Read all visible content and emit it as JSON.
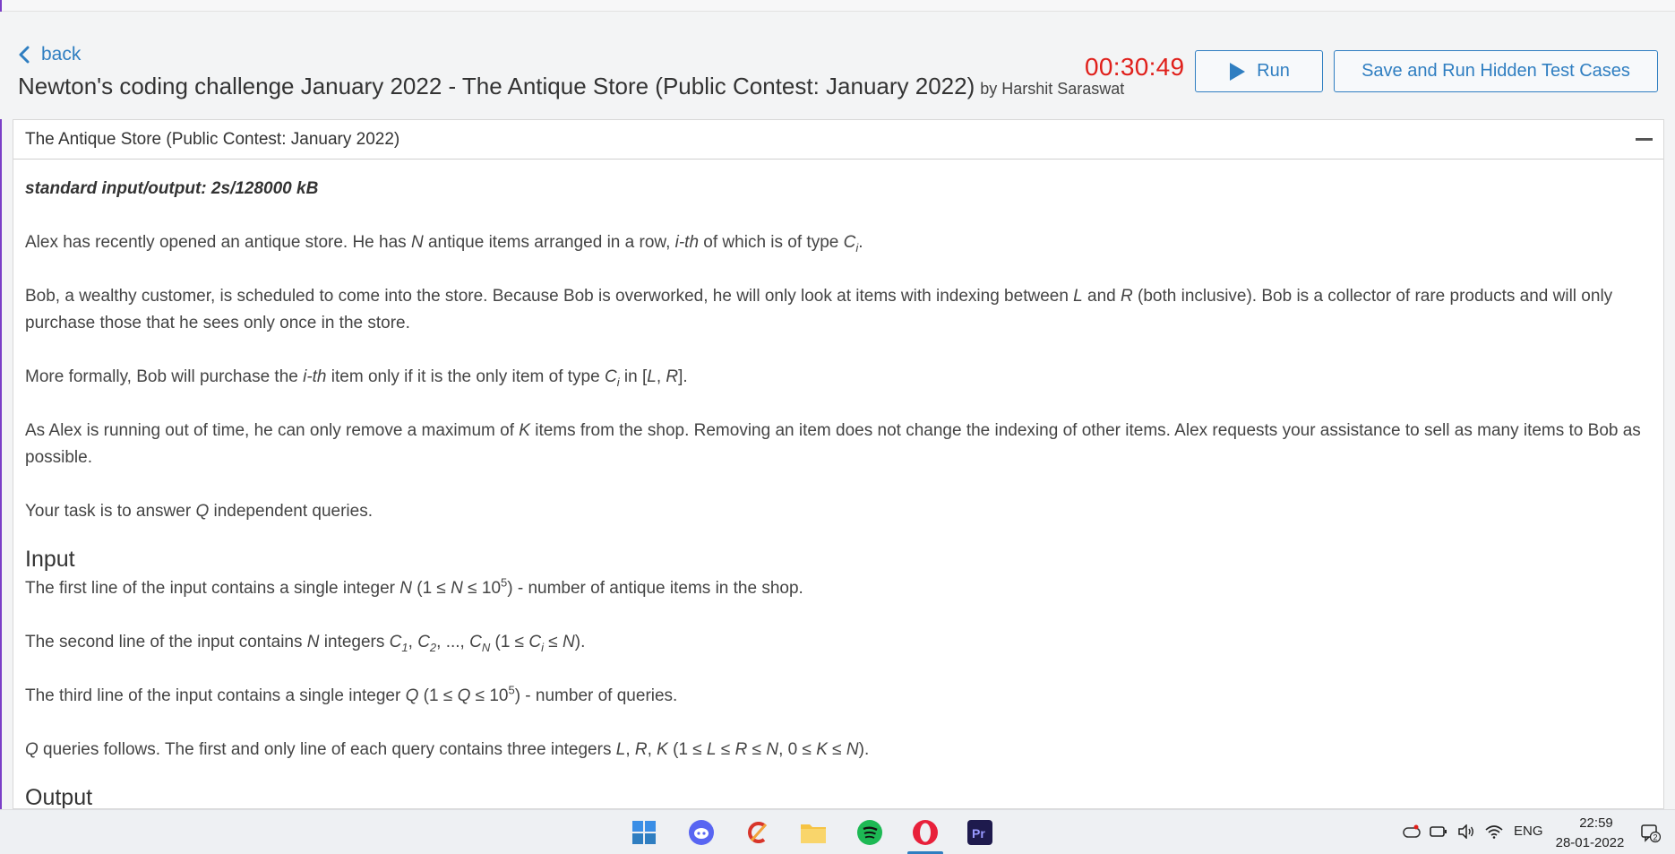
{
  "header": {
    "back_label": "back",
    "title": "Newton's coding challenge January 2022 - The Antique Store (Public Contest: January 2022)",
    "author": "by Harshit Saraswat",
    "timer": "00:30:49",
    "run_label": "Run",
    "hidden_tests_label": "Save and Run Hidden Test Cases"
  },
  "panel": {
    "title": "The Antique Store (Public Contest: January 2022)",
    "limits": "standard input/output: 2s/128000 kB",
    "input_heading": "Input",
    "output_heading": "Output"
  },
  "taskbar": {
    "apps": [
      "windows-start-icon",
      "discord-icon",
      "ccleaner-icon",
      "file-explorer-icon",
      "spotify-icon",
      "opera-icon",
      "premiere-pro-icon"
    ],
    "language": "ENG",
    "time": "22:59",
    "date": "28-01-2022",
    "notification_count": "2"
  },
  "colors": {
    "accent": "#2f7ec1",
    "timer": "#e0201b",
    "background": "#f3f4f5"
  }
}
